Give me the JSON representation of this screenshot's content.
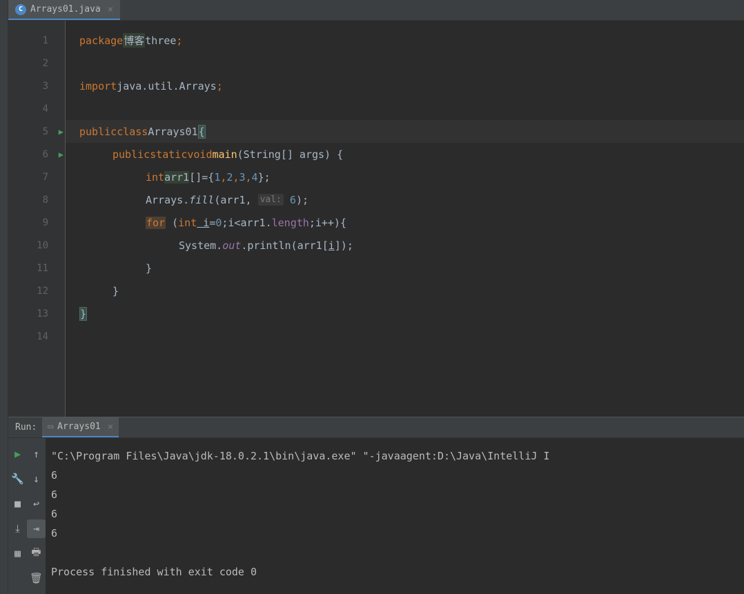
{
  "tab": {
    "label": "Arrays01.java",
    "icon_letter": "C"
  },
  "code": {
    "lines": [
      1,
      2,
      3,
      4,
      5,
      6,
      7,
      8,
      9,
      10,
      11,
      12,
      13,
      14
    ],
    "l1": {
      "kw": "package",
      "pkg": "博客",
      "pkg2": "three",
      "semi": ";"
    },
    "l3": {
      "kw": "import",
      "path": "java.util.Arrays",
      "semi": ";"
    },
    "l5": {
      "kw1": "public",
      "kw2": "class",
      "name": "Arrays01",
      "brace": "{"
    },
    "l6": {
      "kw1": "public",
      "kw2": "static",
      "kw3": "void",
      "meth": "main",
      "params": "(String[] args) {"
    },
    "l7": {
      "kw": "int",
      "var": "arr1",
      "bracket": "[]={",
      "n1": "1",
      "n2": "2",
      "n3": "3",
      "n4": "4",
      "end": "};"
    },
    "l8": {
      "cls": "Arrays.",
      "meth": "fill",
      "open": "(arr1, ",
      "hint": "val:",
      "val": " 6",
      "close": ");"
    },
    "l9": {
      "kw": "for",
      "open": " (",
      "kw2": "int",
      "var": " i",
      "eq": "=",
      "n0": "0",
      "cond": ";i<arr1.",
      "len": "length",
      "inc": ";i++){",
      "underline_i": "i"
    },
    "l10": {
      "sys": "System.",
      "out": "out",
      "dot": ".println(arr1[",
      "var": "i",
      "end": "]);"
    },
    "l11": {
      "brace": "}"
    },
    "l12": {
      "brace": "}"
    },
    "l13": {
      "brace": "}"
    }
  },
  "run": {
    "label": "Run:",
    "tab_label": "Arrays01",
    "output_cmd": "\"C:\\Program Files\\Java\\jdk-18.0.2.1\\bin\\java.exe\" \"-javaagent:D:\\Java\\IntelliJ I",
    "output_lines": [
      "6",
      "6",
      "6",
      "6"
    ],
    "output_end": "Process finished with exit code 0"
  }
}
